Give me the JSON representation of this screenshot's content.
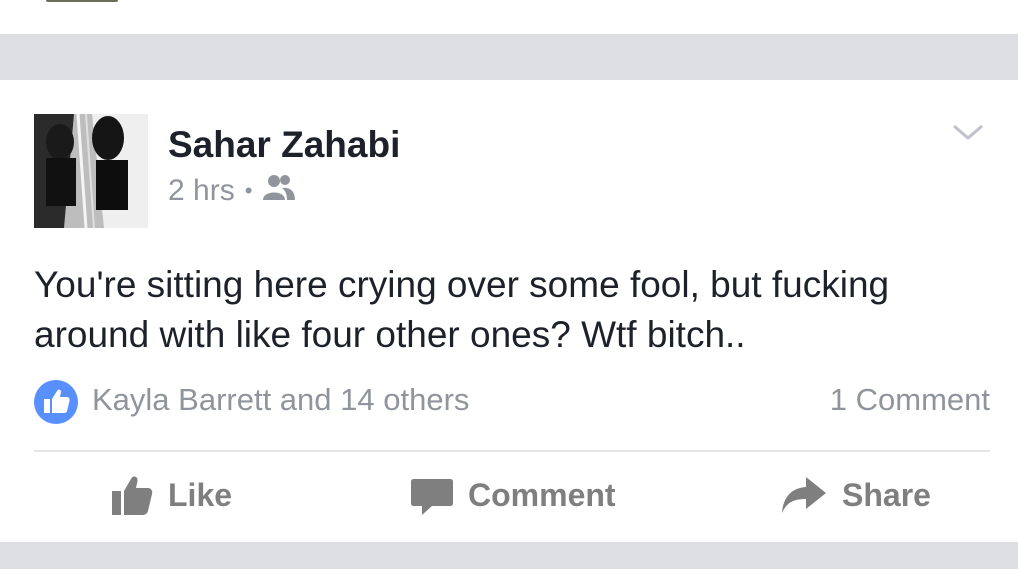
{
  "post": {
    "author": "Sahar Zahabi",
    "time": "2 hrs",
    "separator": "•",
    "privacy_icon": "friends-icon",
    "text": "You're sitting here crying over some fool, but fucking around with like four other ones? Wtf bitch..",
    "likes_text": "Kayla Barrett and 14 others",
    "comments_text": "1 Comment"
  },
  "actions": {
    "like": "Like",
    "comment": "Comment",
    "share": "Share"
  },
  "colors": {
    "like_badge": "#5890ff",
    "secondary_text": "#90949c",
    "primary_text": "#1d2129"
  }
}
